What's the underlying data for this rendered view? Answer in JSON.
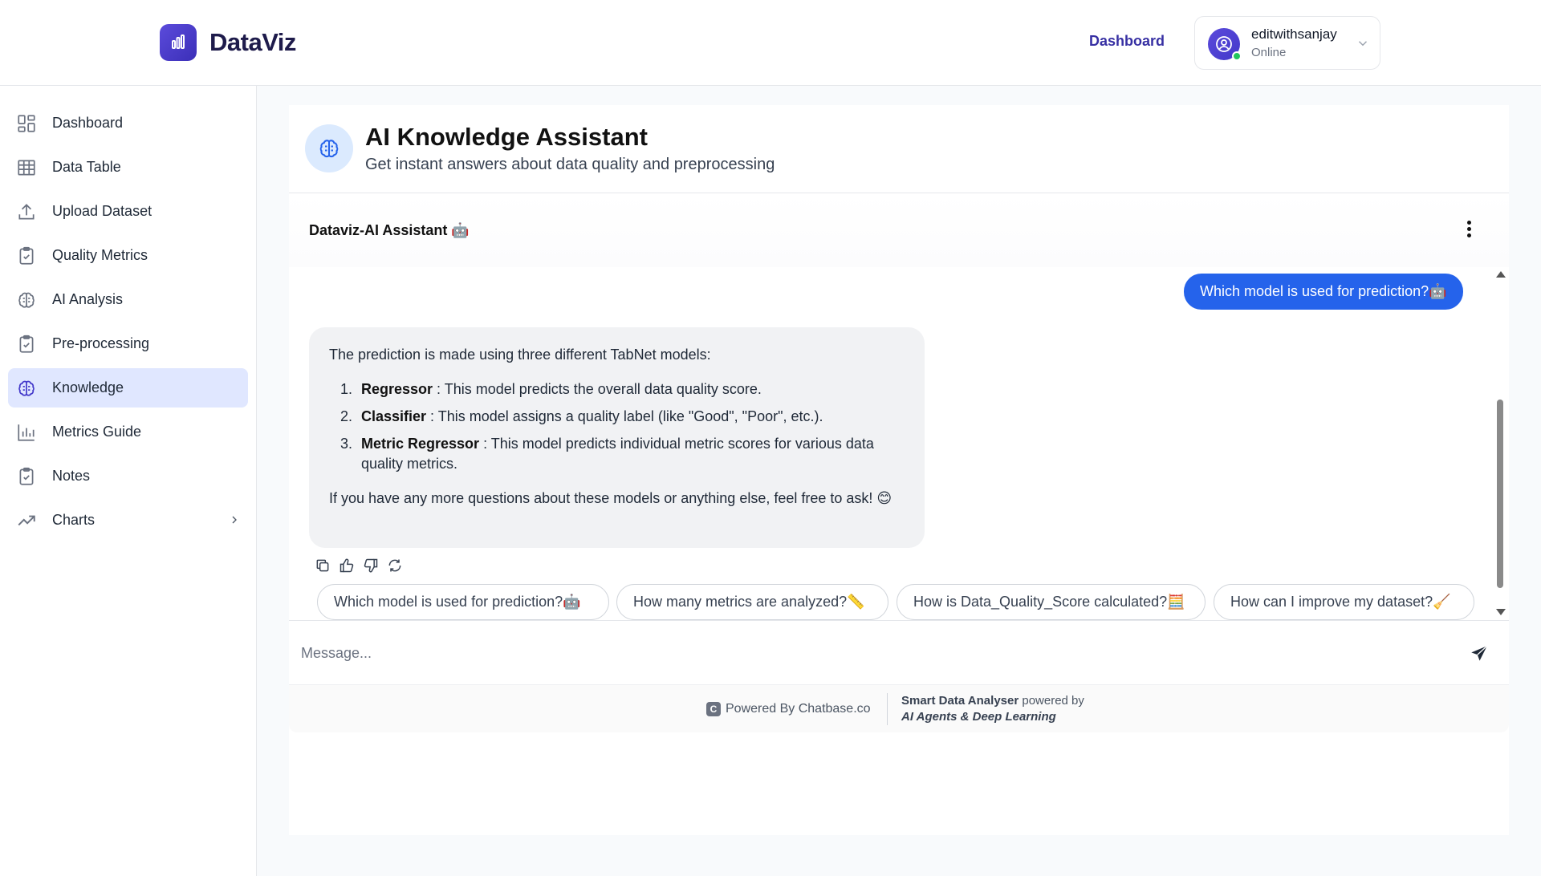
{
  "app": {
    "name": "DataViz"
  },
  "header": {
    "nav_link": "Dashboard",
    "user": {
      "name": "editwithsanjay",
      "status": "Online"
    }
  },
  "sidebar": {
    "items": [
      {
        "label": "Dashboard",
        "icon": "grid-icon"
      },
      {
        "label": "Data Table",
        "icon": "table-icon"
      },
      {
        "label": "Upload Dataset",
        "icon": "upload-icon"
      },
      {
        "label": "Quality Metrics",
        "icon": "clipboard-check-icon"
      },
      {
        "label": "AI Analysis",
        "icon": "brain-icon"
      },
      {
        "label": "Pre-processing",
        "icon": "clipboard-check-icon"
      },
      {
        "label": "Knowledge",
        "icon": "brain-icon",
        "active": true
      },
      {
        "label": "Metrics Guide",
        "icon": "bar-chart-icon"
      },
      {
        "label": "Notes",
        "icon": "clipboard-check-icon"
      },
      {
        "label": "Charts",
        "icon": "trending-up-icon",
        "has_submenu": true
      }
    ]
  },
  "page": {
    "title": "AI Knowledge Assistant",
    "subtitle": "Get instant answers about data quality and preprocessing"
  },
  "chat": {
    "title": "Dataviz-AI Assistant 🤖",
    "user_message": "Which model is used for prediction?🤖",
    "bot_message": {
      "intro": "The prediction is made using three different TabNet models:",
      "items": [
        {
          "term": "Regressor",
          "text": " : This model predicts the overall data quality score."
        },
        {
          "term": "Classifier",
          "text": " : This model assigns a quality label (like \"Good\", \"Poor\", etc.)."
        },
        {
          "term": "Metric Regressor",
          "text": " : This model predicts individual metric scores for various data quality metrics."
        }
      ],
      "outro": "If you have any more questions about these models or anything else, feel free to ask! 😊"
    },
    "suggestions": [
      "Which model is used for prediction?🤖",
      "How many metrics are analyzed?📏",
      "How is Data_Quality_Score calculated?🧮",
      "How can I improve my dataset?🧹"
    ],
    "input_placeholder": "Message...",
    "footer": {
      "powered_by": "Powered By Chatbase.co",
      "brand_bold": "Smart Data Analyser",
      "brand_rest": " powered by",
      "brand_line2": "AI Agents & Deep Learning"
    }
  },
  "colors": {
    "accent": "#4338ca",
    "user_bubble": "#2563eb",
    "active_nav": "#e0e7ff"
  }
}
